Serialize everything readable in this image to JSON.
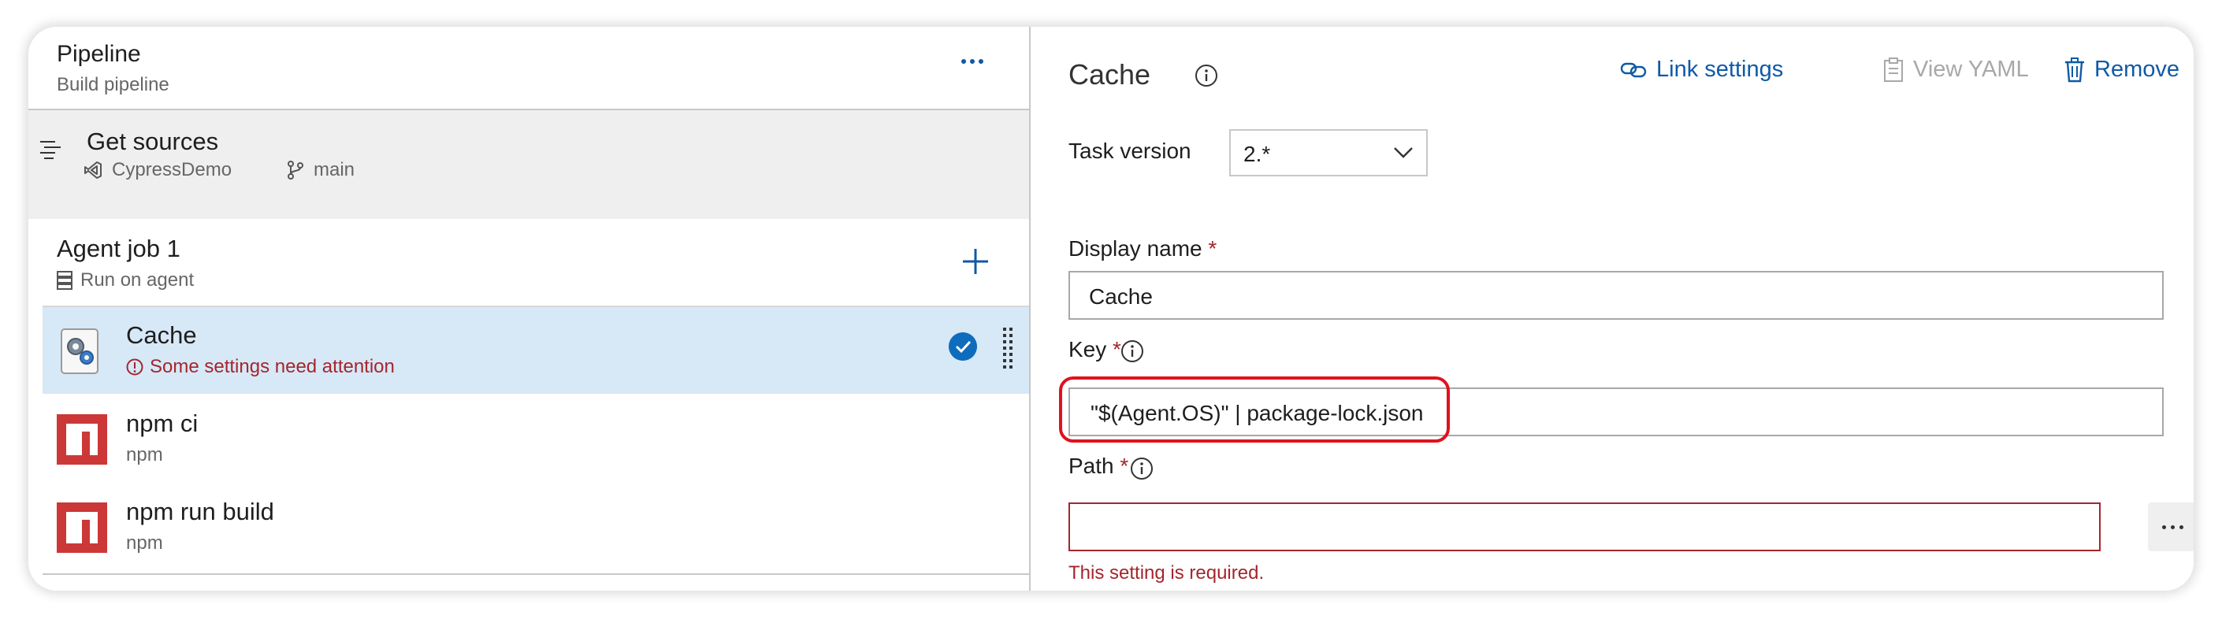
{
  "pipeline": {
    "title": "Pipeline",
    "subtitle": "Build pipeline"
  },
  "sources": {
    "title": "Get sources",
    "repo": "CypressDemo",
    "branch": "main"
  },
  "job": {
    "title": "Agent job 1",
    "subtitle": "Run on agent"
  },
  "tasks": [
    {
      "title": "Cache",
      "subtitle": "Some settings need attention",
      "status": "warning",
      "selected": true
    },
    {
      "title": "npm ci",
      "subtitle": "npm",
      "selected": false
    },
    {
      "title": "npm run build",
      "subtitle": "npm",
      "selected": false
    }
  ],
  "panel": {
    "title": "Cache",
    "link_settings": "Link settings",
    "view_yaml": "View YAML",
    "remove": "Remove",
    "task_version_label": "Task version",
    "task_version_value": "2.*",
    "display_name_label": "Display name",
    "display_name_value": "Cache",
    "key_label": "Key",
    "key_value": "\"$(Agent.OS)\" | package-lock.json",
    "path_label": "Path",
    "path_value": "",
    "required_marker": "*",
    "path_error": "This setting is required."
  },
  "colors": {
    "accent": "#0f5aa6",
    "error": "#a4262c",
    "selected_row": "#d7e8f7",
    "highlight": "#e0121d",
    "npm": "#cb3837"
  },
  "icons": [
    "more-icon",
    "task-list-icon",
    "repo-icon",
    "branch-icon",
    "server-icon",
    "add-icon",
    "gear-icon",
    "warning-icon",
    "check-icon",
    "drag-handle-icon",
    "npm-icon",
    "info-icon",
    "link-icon",
    "clipboard-icon",
    "trash-icon",
    "chevron-down-icon",
    "ellipsis-icon"
  ]
}
